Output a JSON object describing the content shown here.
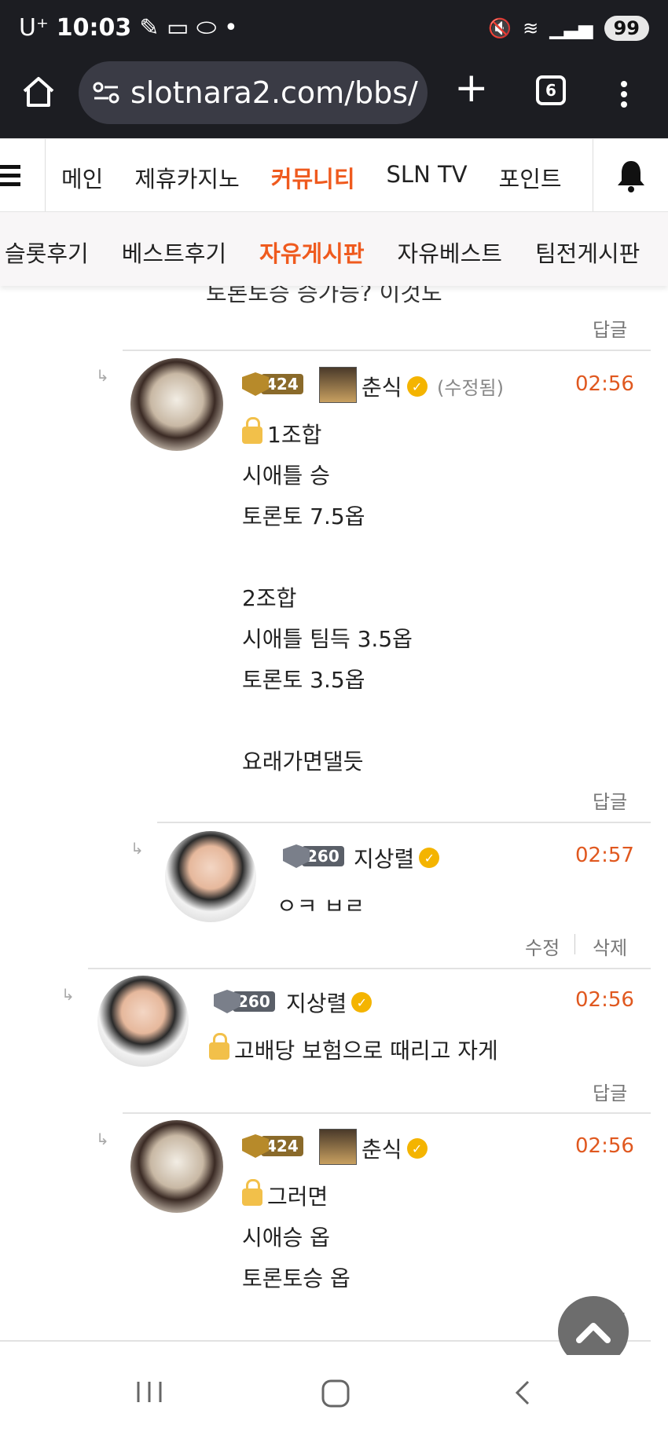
{
  "status": {
    "carrier": "U⁺",
    "time": "10:03",
    "battery": "99"
  },
  "browser": {
    "url": "slotnara2.com/bbs/",
    "tab_count": "6"
  },
  "nav_main": {
    "items": [
      "메인",
      "제휴카지노",
      "커뮤니티",
      "SLN TV",
      "포인트"
    ],
    "active": "커뮤니티"
  },
  "nav_sub": {
    "items": [
      "슬롯후기",
      "베스트후기",
      "자유게시판",
      "자유베스트",
      "팀전게시판"
    ],
    "active": "자유게시판"
  },
  "partial_text": "토론토승 승가능? 이것도",
  "reply_label": "답글",
  "edit_label": "수정",
  "delete_label": "삭제",
  "comments": [
    {
      "user": "춘식",
      "level": "424",
      "edited": "(수정됨)",
      "time": "02:56",
      "lines": [
        "1조합",
        "시애틀 승",
        "토론토 7.5옵",
        "",
        "2조합",
        "시애틀 팀득 3.5옵",
        "토론토 3.5옵",
        "",
        "요래가면댈듯"
      ]
    },
    {
      "user": "지상렬",
      "level": "260",
      "time": "02:57",
      "lines": [
        "ㅇㅋ ㅂㄹ"
      ]
    },
    {
      "user": "지상렬",
      "level": "260",
      "time": "02:56",
      "lines": [
        "고배당 보험으로 때리고  자게"
      ]
    },
    {
      "user": "춘식",
      "level": "424",
      "time": "02:56",
      "lines": [
        "그러면",
        "시애승 옵",
        "토론토승 옵"
      ]
    }
  ],
  "colors": {
    "accent": "#ef5a1e",
    "time": "#e0581f",
    "verified": "#f4b400"
  }
}
